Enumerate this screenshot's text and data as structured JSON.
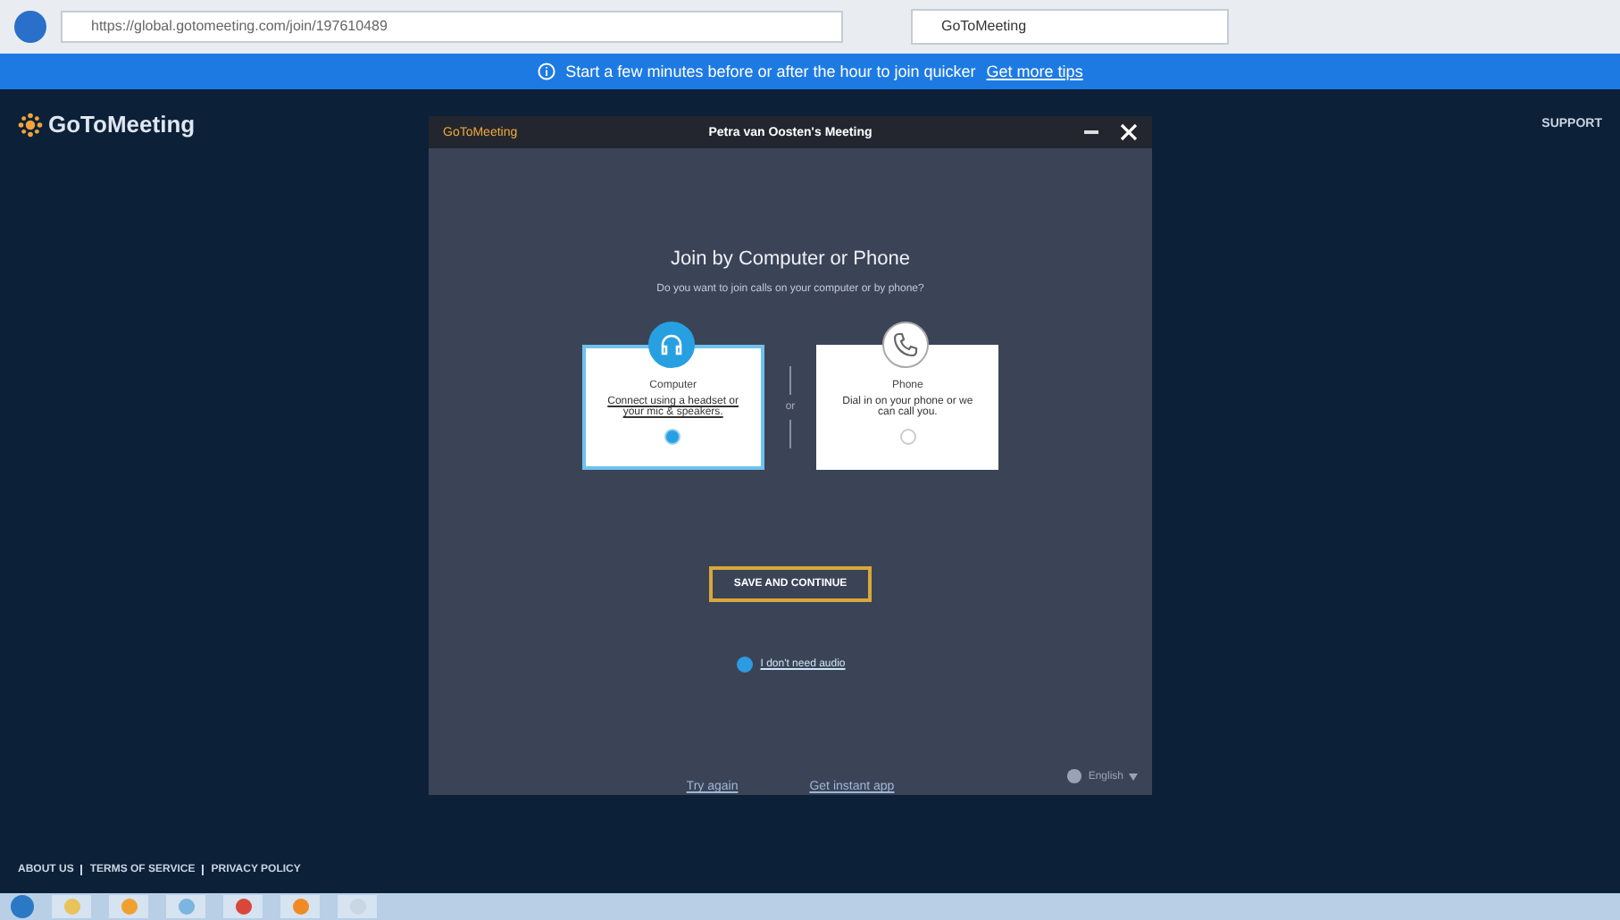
{
  "browser": {
    "url": "https://global.gotomeeting.com/join/197610489",
    "tab_title": "GoToMeeting"
  },
  "banner": {
    "text": "Start a few minutes before or after the hour to join quicker",
    "link": "Get more tips"
  },
  "page": {
    "logo": "GoToMeeting",
    "support": "SUPPORT",
    "behind_links": [
      "Try again",
      "Get instant app"
    ],
    "footer": [
      "ABOUT US",
      "TERMS OF SERVICE",
      "PRIVACY POLICY"
    ]
  },
  "dialog": {
    "logo": "GoToMeeting",
    "title": "Petra van Oosten's Meeting",
    "heading": "Join by Computer or Phone",
    "subheading": "Do you want to join calls on your computer or by phone?",
    "options": [
      {
        "kind": "computer",
        "title": "Computer",
        "text": "Connect using a headset or your mic & speakers.",
        "selected": true
      },
      {
        "kind": "phone",
        "title": "Phone",
        "text": "Dial in on your phone or we can call you.",
        "selected": false
      }
    ],
    "divider": "or",
    "button": "SAVE AND CONTINUE",
    "no_audio": "I don't need audio",
    "language": "English"
  },
  "taskbar": {
    "apps": [
      {
        "kind": "folder"
      },
      {
        "kind": "media"
      },
      {
        "kind": "explorer"
      },
      {
        "kind": "chrome"
      },
      {
        "kind": "firefox"
      },
      {
        "kind": "notepad"
      }
    ]
  }
}
